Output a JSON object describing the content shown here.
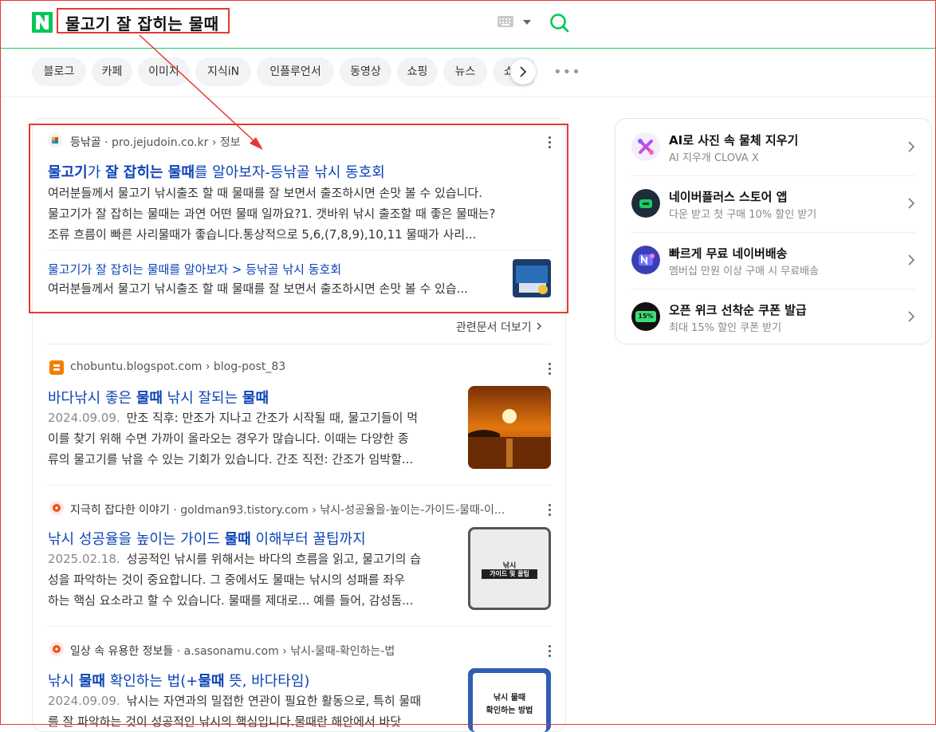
{
  "header": {
    "logo_letter": "N",
    "query": "물고기 잘 잡히는 물때"
  },
  "tabs": [
    "블로그",
    "카페",
    "이미지",
    "지식iN",
    "인플루언서",
    "동영상",
    "쇼핑",
    "뉴스",
    "쇼"
  ],
  "results": {
    "r1": {
      "site_name": "등낚골",
      "url": "pro.jejudoin.co.kr › 정보",
      "title_parts": [
        "물고기",
        "가 ",
        "잘 잡히는 물때",
        "를 알아보자-등낚골 낚시 동호회"
      ],
      "snippet_lines": [
        "여러분들께서 물고기 낚시출조 할 때 물때를 잘 보면서 출조하시면 손맛 볼 수 있습니다.",
        "물고기가 잘 잡히는 물때는 과연 어떤 물때 일까요?1. 갯바위 낚시 출조할 때 좋은 물때는?",
        "조류 흐름이 빠른 사리물때가 좋습니다.통상적으로 5,6,(7,8,9),10,11 물때가 사리..."
      ],
      "sub_link": "물고기가 잘 잡히는 물때를 알아보자 > 등낚골 낚시 동호회",
      "sub_snippet": "여러분들께서 물고기 낚시출조 할 때 물때를 잘 보면서 출조하시면 손맛 볼 수 있습..."
    },
    "related_more": "관련문서 더보기",
    "r2": {
      "url": "chobuntu.blogspot.com › blog-post_83",
      "title_parts": [
        "바다낚시 좋은 ",
        "물때",
        " 낚시 잘되는 ",
        "물때"
      ],
      "date": "2024.09.09.",
      "snippet_lines": [
        "만조 직후: 만조가 지나고 간조가 시작될 때, 물고기들이 먹",
        "이를 찾기 위해 수면 가까이 올라오는 경우가 많습니다. 이때는 다양한 종",
        "류의 물고기를 낚을 수 있는 기회가 있습니다. 간조 직전: 간조가 임박할..."
      ]
    },
    "r3": {
      "site_name": "지극히 잡다한 이야기",
      "url": "goldman93.tistory.com › 낚시-성공율을-높이는-가이드-물때-이...",
      "title_parts": [
        "낚시 성공율을 높이는 가이드 ",
        "물때",
        " 이해부터 꿀팁까지"
      ],
      "date": "2025.02.18.",
      "snippet_lines": [
        "성공적인 낚시를 위해서는 바다의 흐름을 읽고, 물고기의 습",
        "성을 파악하는 것이 중요합니다. 그 중에서도 물때는 낚시의 성패를 좌우",
        "하는 핵심 요소라고 할 수 있습니다. 물때를 제대로... 예를 들어, 감성돔..."
      ],
      "thumb_text": [
        "낚시",
        "가이드 및 꿀팁"
      ]
    },
    "r4": {
      "site_name": "일상 속 유용한 정보들",
      "url": "a.sasonamu.com › 낚시-물때-확인하는-법",
      "title_parts": [
        "낚시 ",
        "물때",
        " 확인하는 법(+",
        "물때",
        " 뜻, 바다타임)"
      ],
      "date": "2024.09.09.",
      "snippet_lines": [
        "낚시는 자연과의 밀접한 연관이 필요한 활동으로, 특히 물때",
        "를 잘 파악하는 것이 성공적인 낚시의 핵심입니다.물때란 해안에서 바닷"
      ],
      "thumb_text": [
        "낚시 물때",
        "확인하는 방법"
      ]
    }
  },
  "sidebar": [
    {
      "title": "AI로 사진 속 물체 지우기",
      "sub": "AI 지우개 CLOVA X",
      "color": "#f3eefc"
    },
    {
      "title": "네이버플러스 스토어 앱",
      "sub": "다운 받고 첫 구매 10% 할인 받기",
      "color": "#1f2d3a"
    },
    {
      "title": "빠르게 무료 네이버배송",
      "sub": "멤버십 만원 이상 구매 시 무료배송",
      "color": "#3a3fb5"
    },
    {
      "title": "오픈 위크 선착순 쿠폰 발급",
      "sub": "최대 15% 할인 쿠폰 받기",
      "badge": "15%",
      "color": "#111111"
    }
  ],
  "colors": {
    "naver_green": "#03c75a",
    "link_blue": "#0c43b7",
    "annotation_red": "#e53935"
  },
  "icons": [
    "search-icon",
    "keyboard-icon",
    "chevron-right-icon",
    "more-icon"
  ]
}
